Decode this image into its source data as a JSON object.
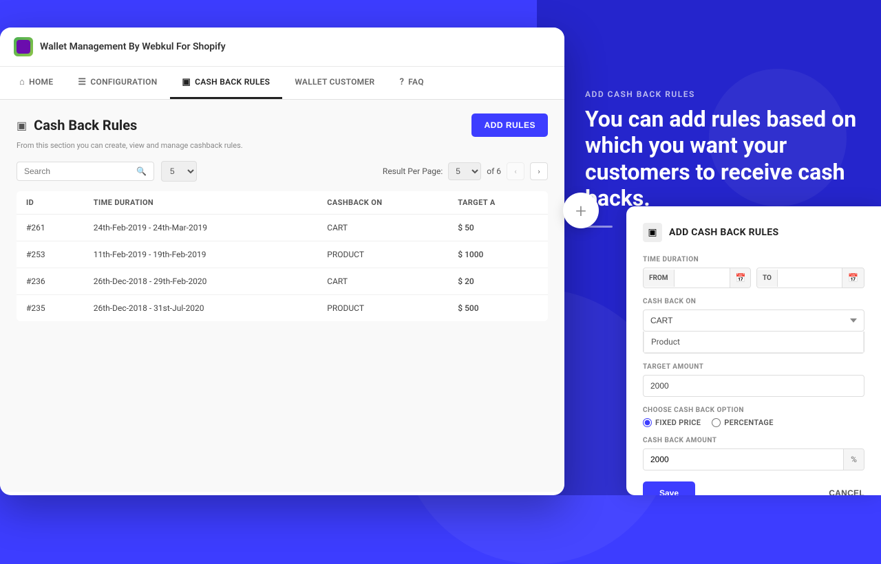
{
  "app": {
    "title": "Wallet Management By Webkul For Shopify"
  },
  "nav": {
    "tabs": [
      {
        "id": "home",
        "label": "HOME",
        "icon": "⌂",
        "active": false
      },
      {
        "id": "configuration",
        "label": "CONFIGURATION",
        "icon": "☰",
        "active": false
      },
      {
        "id": "cashback_rules",
        "label": "CASH BACK RULES",
        "icon": "▣",
        "active": true
      },
      {
        "id": "wallet_customer",
        "label": "WALLET CUSTOMER",
        "icon": "",
        "active": false
      },
      {
        "id": "faq",
        "label": "FAQ",
        "icon": "?",
        "active": false
      }
    ]
  },
  "page": {
    "title": "Cash Back Rules",
    "subtitle": "From this section you can create, view and manage cashback rules.",
    "add_rules_btn": "ADD RULES"
  },
  "toolbar": {
    "search_placeholder": "Search",
    "result_per_page_label": "Result Per Page:",
    "per_page_value": "5",
    "of_label": "of 6"
  },
  "table": {
    "columns": [
      "ID",
      "TIME DURATION",
      "CASHBACK ON",
      "TARGET A"
    ],
    "rows": [
      {
        "id": "#261",
        "duration": "24th-Feb-2019 - 24th-Mar-2019",
        "cashback_on": "CART",
        "target_amount": "$ 50"
      },
      {
        "id": "#253",
        "duration": "11th-Feb-2019 - 19th-Feb-2019",
        "cashback_on": "PRODUCT",
        "target_amount": "$ 1000"
      },
      {
        "id": "#236",
        "duration": "26th-Dec-2018 - 29th-Feb-2020",
        "cashback_on": "CART",
        "target_amount": "$ 20"
      },
      {
        "id": "#235",
        "duration": "26th-Dec-2018 - 31st-Jul-2020",
        "cashback_on": "PRODUCT",
        "target_amount": "$ 500"
      }
    ]
  },
  "panel": {
    "title": "ADD CASH BACK RULES",
    "time_duration_label": "TIME DURATION",
    "from_label": "FROM",
    "to_label": "TO",
    "cashback_on_label": "CASH BACK ON",
    "cashback_on_value": "CART",
    "dropdown_option": "Product",
    "target_amount_label": "TARGET AMOUNT",
    "target_amount_value": "2000",
    "cashback_option_label": "CHOOSE CASH BACK OPTION",
    "fixed_price_label": "FIXED PRICE",
    "percentage_label": "PERCENTAGE",
    "cashback_amount_label": "CASH BACK  AMOUNT",
    "cashback_amount_value": "2000",
    "save_btn": "Save",
    "cancel_btn": "CANCEL"
  },
  "right_info": {
    "label": "ADD CASH BACK RULES",
    "text": "You can add rules based on which you want your customers to receive cash backs."
  },
  "plus_btn_label": "+"
}
